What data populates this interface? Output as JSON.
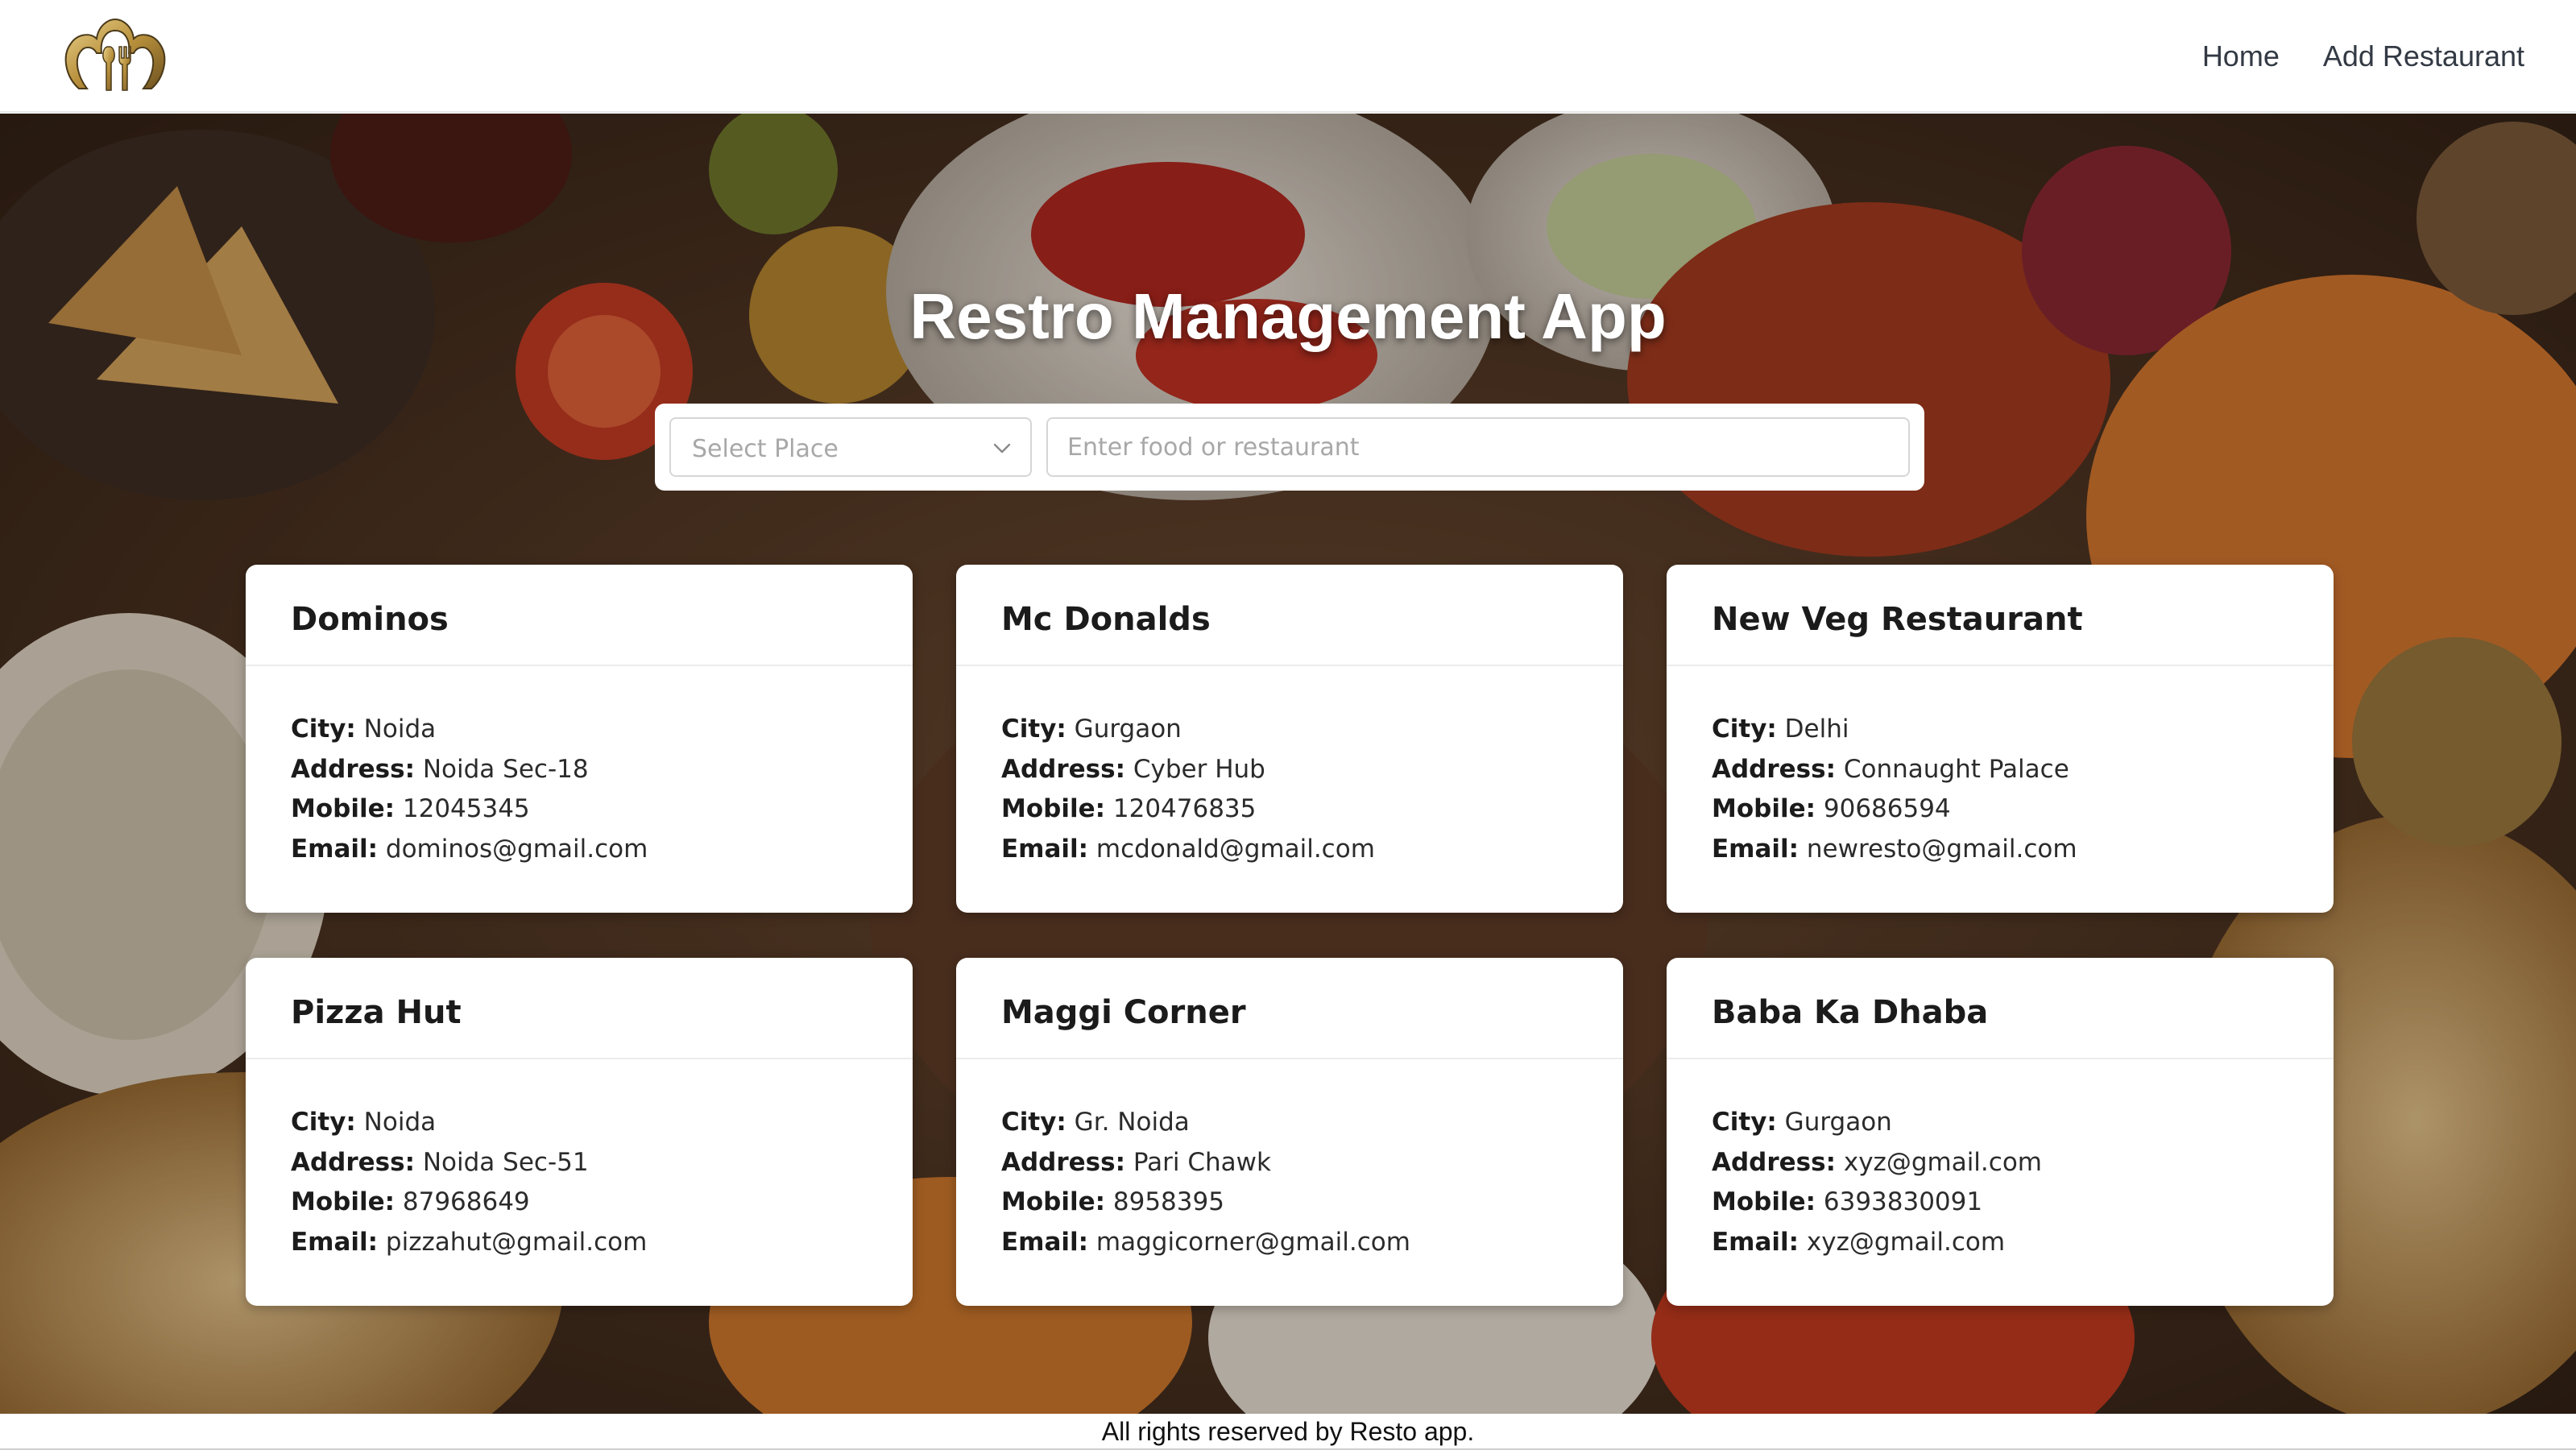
{
  "header": {
    "logo_icon": "chef-hat-cutlery-icon",
    "nav": [
      {
        "label": "Home"
      },
      {
        "label": "Add Restaurant"
      }
    ]
  },
  "hero": {
    "title": "Restro Management App",
    "background": "food-spread-photo",
    "search": {
      "place_placeholder": "Select Place",
      "query_placeholder": "Enter food or restaurant"
    }
  },
  "field_labels": {
    "city": "City:",
    "address": "Address:",
    "mobile": "Mobile:",
    "email": "Email:"
  },
  "restaurants": [
    {
      "name": "Dominos",
      "city": "Noida",
      "address": "Noida Sec-18",
      "mobile": "12045345",
      "email": "dominos@gmail.com"
    },
    {
      "name": "Mc Donalds",
      "city": "Gurgaon",
      "address": "Cyber Hub",
      "mobile": "120476835",
      "email": "mcdonald@gmail.com"
    },
    {
      "name": "New Veg Restaurant",
      "city": "Delhi",
      "address": "Connaught Palace",
      "mobile": "90686594",
      "email": "newresto@gmail.com"
    },
    {
      "name": "Pizza Hut",
      "city": "Noida",
      "address": "Noida Sec-51",
      "mobile": "87968649",
      "email": "pizzahut@gmail.com"
    },
    {
      "name": "Maggi Corner",
      "city": "Gr. Noida",
      "address": "Pari Chawk",
      "mobile": "8958395",
      "email": "maggicorner@gmail.com"
    },
    {
      "name": "Baba Ka Dhaba",
      "city": "Gurgaon",
      "address": "xyz@gmail.com",
      "mobile": "6393830091",
      "email": "xyz@gmail.com"
    }
  ],
  "footer": {
    "text": "All rights reserved by Resto app."
  }
}
